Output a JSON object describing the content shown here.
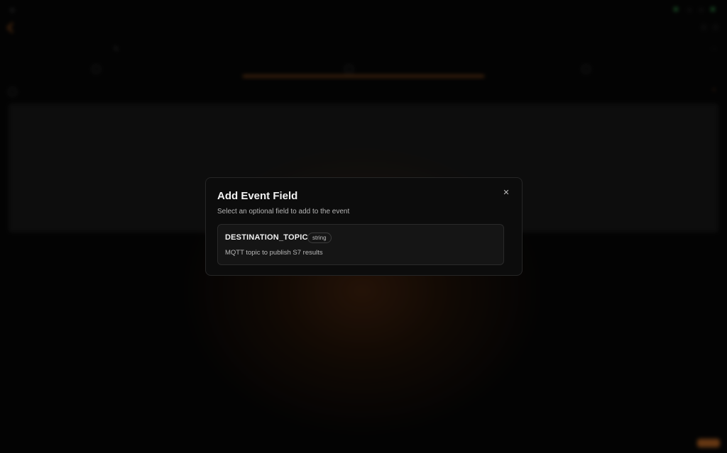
{
  "modal": {
    "title": "Add Event Field",
    "subtitle": "Select an optional field to add to the event",
    "close_icon": "close-icon",
    "options": [
      {
        "name": "DESTINATION_TOPIC",
        "type": "string",
        "description": "MQTT topic to publish S7 results"
      }
    ]
  },
  "background": {
    "accent_color": "#e07a2a",
    "status_color": "#3fbf5a"
  }
}
